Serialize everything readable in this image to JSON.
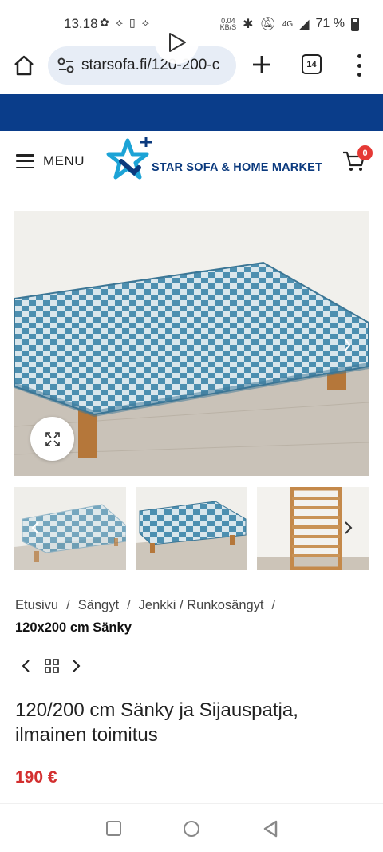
{
  "status": {
    "time": "13.18",
    "net_speed": "0.04",
    "net_unit": "KB/S",
    "signal": "4G",
    "battery": "71 %"
  },
  "browser": {
    "url": "starsofa.fi/120-200-c",
    "tab_count": "14"
  },
  "header": {
    "menu_label": "MENU",
    "logo_text": "STAR SOFA & HOME MARKET",
    "cart_count": "0"
  },
  "breadcrumb": {
    "items": [
      "Etusivu",
      "Sängyt",
      "Jenkki / Runkosängyt"
    ],
    "separator": "/",
    "current": "120x200 cm Sänky"
  },
  "product": {
    "title": "120/200 cm Sänky ja Sijauspatja, ilmainen toimitus",
    "price": "190 €"
  },
  "colors": {
    "brand_blue": "#0a3d8a",
    "logo_cyan": "#1ca3d6",
    "price_red": "#d32f2f",
    "badge_red": "#e53935"
  },
  "icons": [
    "home-icon",
    "site-settings-icon",
    "plus-icon",
    "tabs-icon",
    "more-icon",
    "hamburger-icon",
    "cart-icon",
    "expand-icon",
    "play-icon",
    "chevron-left-icon",
    "chevron-right-icon",
    "grid-icon"
  ]
}
